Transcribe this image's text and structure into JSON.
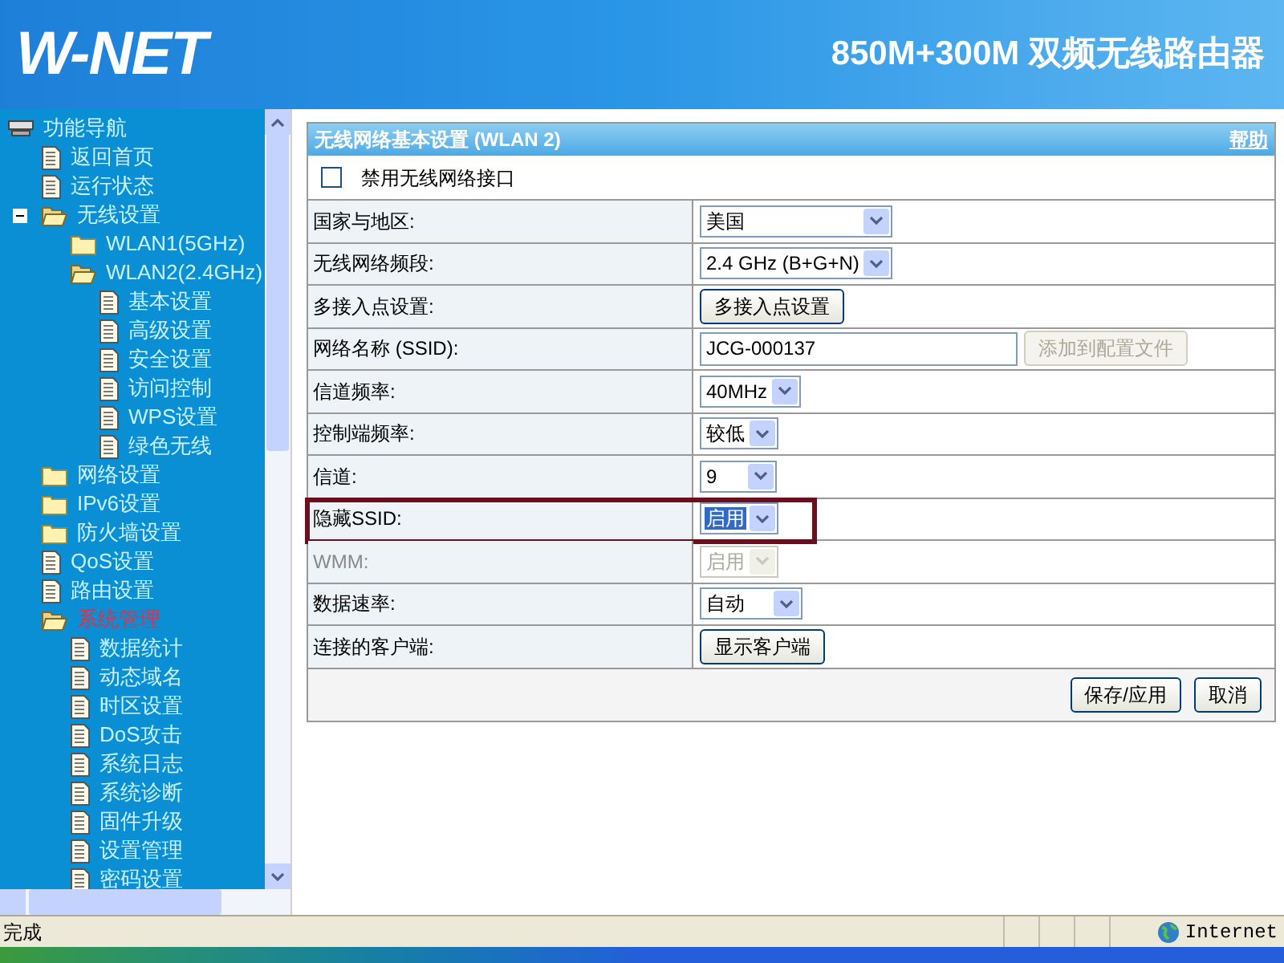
{
  "header": {
    "logo": "W-NET",
    "title": "850M+300M 双频无线路由器"
  },
  "nav": {
    "title": "功能导航",
    "items": [
      {
        "kind": "page",
        "label": "返回首页",
        "selected": false
      },
      {
        "kind": "page",
        "label": "运行状态",
        "selected": false
      },
      {
        "kind": "folder",
        "label": "无线设置",
        "selected": false,
        "expanded": true,
        "has_toggle": true,
        "children": [
          {
            "kind": "folder",
            "label": "WLAN1(5GHz)",
            "selected": false,
            "expanded": false,
            "has_toggle": false
          },
          {
            "kind": "folder",
            "label": "WLAN2(2.4GHz)",
            "selected": false,
            "expanded": true,
            "has_toggle": false,
            "children": [
              {
                "kind": "page",
                "label": "基本设置",
                "selected": false
              },
              {
                "kind": "page",
                "label": "高级设置",
                "selected": false
              },
              {
                "kind": "page",
                "label": "安全设置",
                "selected": false
              },
              {
                "kind": "page",
                "label": "访问控制",
                "selected": false
              },
              {
                "kind": "page",
                "label": "WPS设置",
                "selected": false
              },
              {
                "kind": "page",
                "label": "绿色无线",
                "selected": false
              }
            ]
          }
        ]
      },
      {
        "kind": "folder",
        "label": "网络设置",
        "selected": false,
        "expanded": false,
        "has_toggle": false
      },
      {
        "kind": "folder",
        "label": "IPv6设置",
        "selected": false,
        "expanded": false,
        "has_toggle": false
      },
      {
        "kind": "folder",
        "label": "防火墙设置",
        "selected": false,
        "expanded": false,
        "has_toggle": false
      },
      {
        "kind": "page",
        "label": "QoS设置",
        "selected": false
      },
      {
        "kind": "page",
        "label": "路由设置",
        "selected": false
      },
      {
        "kind": "folder",
        "label": "系统管理",
        "selected": true,
        "expanded": true,
        "has_toggle": false,
        "children": [
          {
            "kind": "page",
            "label": "数据统计",
            "selected": false
          },
          {
            "kind": "page",
            "label": "动态域名",
            "selected": false
          },
          {
            "kind": "page",
            "label": "时区设置",
            "selected": false
          },
          {
            "kind": "page",
            "label": "DoS攻击",
            "selected": false
          },
          {
            "kind": "page",
            "label": "系统日志",
            "selected": false
          },
          {
            "kind": "page",
            "label": "系统诊断",
            "selected": false
          },
          {
            "kind": "page",
            "label": "固件升级",
            "selected": false
          },
          {
            "kind": "page",
            "label": "设置管理",
            "selected": false
          },
          {
            "kind": "page",
            "label": "密码设置",
            "selected": false
          }
        ]
      }
    ]
  },
  "panel": {
    "title": "无线网络基本设置 (WLAN 2)",
    "help": "帮助",
    "disable_checkbox": {
      "label": "禁用无线网络接口",
      "checked": false
    },
    "rows": [
      {
        "kind": "select",
        "label": "国家与地区:",
        "value": "美国",
        "disabled": false,
        "highlighted": false
      },
      {
        "kind": "select",
        "label": "无线网络频段:",
        "value": "2.4 GHz (B+G+N)",
        "disabled": false,
        "highlighted": false
      },
      {
        "kind": "button",
        "label": "多接入点设置:",
        "value": "多接入点设置",
        "disabled": false,
        "highlighted": false
      },
      {
        "kind": "text",
        "label": "网络名称 (SSID):",
        "value": "JCG-000137",
        "button": "添加到配置文件",
        "disabled": false,
        "highlighted": false
      },
      {
        "kind": "select",
        "label": "信道频率:",
        "value": "40MHz",
        "disabled": false,
        "highlighted": false
      },
      {
        "kind": "select",
        "label": "控制端频率:",
        "value": "较低",
        "disabled": false,
        "highlighted": false
      },
      {
        "kind": "select",
        "label": "信道:",
        "value": "9",
        "disabled": false,
        "highlighted": false
      },
      {
        "kind": "select",
        "label": "隐藏SSID:",
        "value": "启用",
        "disabled": false,
        "highlighted": true
      },
      {
        "kind": "select",
        "label": "WMM:",
        "value": "启用",
        "disabled": true,
        "highlighted": false
      },
      {
        "kind": "select",
        "label": "数据速率:",
        "value": "自动",
        "disabled": false,
        "highlighted": false
      },
      {
        "kind": "button",
        "label": "连接的客户端:",
        "value": "显示客户端",
        "disabled": false,
        "highlighted": false
      }
    ],
    "actions": [
      "保存/应用",
      "取消"
    ]
  },
  "status_bar": {
    "text": "完成",
    "zone": "Internet"
  }
}
